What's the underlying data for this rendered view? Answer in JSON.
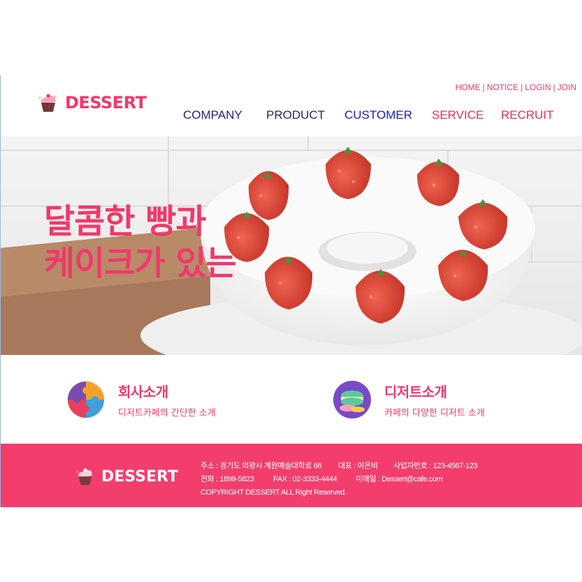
{
  "header": {
    "logo_text": "DESSERT",
    "util_links": [
      "HOME",
      "NOTICE",
      "LOGIN",
      "JOIN"
    ],
    "nav": [
      {
        "label": "COMPANY",
        "color": "#2d1f6e"
      },
      {
        "label": "PRODUCT",
        "color": "#2d1f6e"
      },
      {
        "label": "CUSTOMER",
        "color": "#1a1ad0"
      },
      {
        "label": "SERVICE",
        "color": "#e0305f"
      },
      {
        "label": "RECRUIT",
        "color": "#e0305f"
      }
    ]
  },
  "hero": {
    "line1": "달콤한 빵과",
    "line2": "케이크가 있는"
  },
  "intro": [
    {
      "title": "회사소개",
      "desc": "디저트카페의 간단한 소개",
      "icon": "puzzle-icon"
    },
    {
      "title": "디저트소개",
      "desc": "카페의 다양한 디저트 소개",
      "icon": "macaron-icon"
    }
  ],
  "footer": {
    "logo_text": "DESSERT",
    "address": "주소 : 경기도 의왕시 계원예술대학로 66",
    "ceo": "대표 : 이은비",
    "biz_no": "사업자번호 : 123-4567-123",
    "phone": "전화 : 1899-5823",
    "fax": "FAX : 02-3333-4444",
    "email": "이메일 : Dessert@cafe.com",
    "copyright": "COPYRIGHT DESSERT ALL Right Reserved."
  },
  "colors": {
    "brand": "#f0386b",
    "footer_bg": "#f33d6c"
  }
}
